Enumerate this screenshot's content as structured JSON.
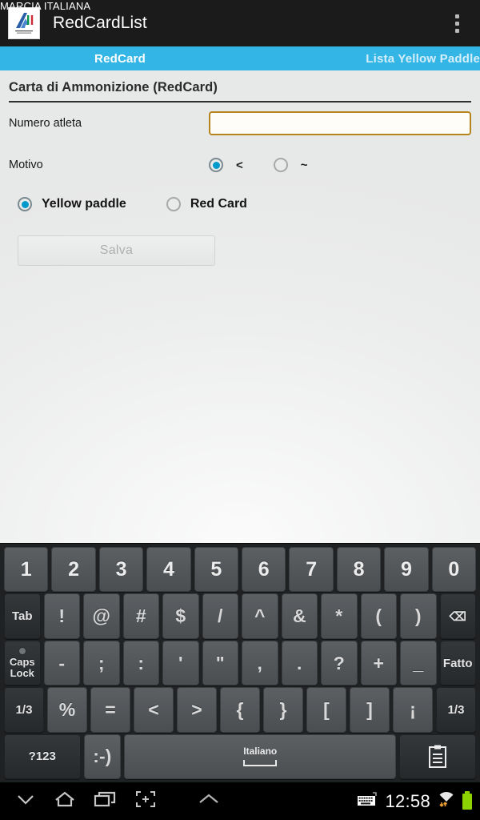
{
  "status_overlay": {
    "text": "MARCIA ITALIANA"
  },
  "actionbar": {
    "logo_icon": "fidal-logo-icon",
    "title": "RedCardList",
    "overflow_icon": "overflow-menu-icon"
  },
  "tabs": [
    {
      "label": "RedCard",
      "active": true
    },
    {
      "label": "Lista Yellow Paddle",
      "active": false
    }
  ],
  "form": {
    "section_title": "Carta di Ammonizione (RedCard)",
    "athlete_number": {
      "label": "Numero atleta",
      "value": "",
      "placeholder": ""
    },
    "motivo": {
      "label": "Motivo",
      "options": [
        {
          "label": "<",
          "checked": true
        },
        {
          "label": "~",
          "checked": false
        }
      ]
    },
    "card_type": {
      "options": [
        {
          "label": "Yellow paddle",
          "checked": true
        },
        {
          "label": "Red Card",
          "checked": false
        }
      ]
    },
    "save_button": {
      "label": "Salva",
      "enabled": false
    }
  },
  "keyboard": {
    "rows": [
      {
        "keys": [
          {
            "label": "1",
            "name": "key-1",
            "style": "num"
          },
          {
            "label": "2",
            "name": "key-2",
            "style": "num"
          },
          {
            "label": "3",
            "name": "key-3",
            "style": "num"
          },
          {
            "label": "4",
            "name": "key-4",
            "style": "num"
          },
          {
            "label": "5",
            "name": "key-5",
            "style": "num"
          },
          {
            "label": "6",
            "name": "key-6",
            "style": "num"
          },
          {
            "label": "7",
            "name": "key-7",
            "style": "num"
          },
          {
            "label": "8",
            "name": "key-8",
            "style": "num"
          },
          {
            "label": "9",
            "name": "key-9",
            "style": "num"
          },
          {
            "label": "0",
            "name": "key-0",
            "style": "num"
          }
        ]
      },
      {
        "keys": [
          {
            "label": "Tab",
            "name": "key-tab",
            "style": "fn dark"
          },
          {
            "label": "!",
            "name": "key-exclam",
            "style": "sym"
          },
          {
            "label": "@",
            "name": "key-at",
            "style": "sym"
          },
          {
            "label": "#",
            "name": "key-hash",
            "style": "sym"
          },
          {
            "label": "$",
            "name": "key-dollar",
            "style": "sym"
          },
          {
            "label": "/",
            "name": "key-slash",
            "style": "sym"
          },
          {
            "label": "^",
            "name": "key-caret",
            "style": "sym"
          },
          {
            "label": "&",
            "name": "key-ampersand",
            "style": "sym"
          },
          {
            "label": "*",
            "name": "key-asterisk",
            "style": "sym"
          },
          {
            "label": "(",
            "name": "key-paren-open",
            "style": "sym"
          },
          {
            "label": ")",
            "name": "key-paren-close",
            "style": "sym"
          },
          {
            "label": "⌫",
            "name": "backspace-icon",
            "style": "fn dark"
          }
        ]
      },
      {
        "keys": [
          {
            "label": "Caps Lock",
            "name": "key-caps-lock",
            "style": "tiny dark"
          },
          {
            "label": "-",
            "name": "key-hyphen",
            "style": "sym"
          },
          {
            "label": ";",
            "name": "key-semicolon",
            "style": "sym"
          },
          {
            "label": ":",
            "name": "key-colon",
            "style": "sym"
          },
          {
            "label": "'",
            "name": "key-apostrophe",
            "style": "sym"
          },
          {
            "label": "\"",
            "name": "key-quote",
            "style": "sym"
          },
          {
            "label": ",",
            "name": "key-comma",
            "style": "sym"
          },
          {
            "label": ".",
            "name": "key-period",
            "style": "sym"
          },
          {
            "label": "?",
            "name": "key-question",
            "style": "sym"
          },
          {
            "label": "+",
            "name": "key-plus",
            "style": "sym"
          },
          {
            "label": "_",
            "name": "key-underscore",
            "style": "sym"
          },
          {
            "label": "Fatto",
            "name": "key-done",
            "style": "fn dark"
          }
        ]
      },
      {
        "keys": [
          {
            "label": "1/3",
            "name": "key-page-left",
            "style": "fn dark"
          },
          {
            "label": "%",
            "name": "key-percent",
            "style": "sym"
          },
          {
            "label": "=",
            "name": "key-equals",
            "style": "sym"
          },
          {
            "label": "<",
            "name": "key-less-than",
            "style": "sym"
          },
          {
            "label": ">",
            "name": "key-greater-than",
            "style": "sym"
          },
          {
            "label": "{",
            "name": "key-brace-open",
            "style": "sym"
          },
          {
            "label": "}",
            "name": "key-brace-close",
            "style": "sym"
          },
          {
            "label": "[",
            "name": "key-bracket-open",
            "style": "sym"
          },
          {
            "label": "]",
            "name": "key-bracket-close",
            "style": "sym"
          },
          {
            "label": "¡",
            "name": "key-inverted-exclam",
            "style": "sym"
          },
          {
            "label": "1/3",
            "name": "key-page-right",
            "style": "fn dark"
          }
        ]
      }
    ],
    "bottom_row": {
      "symbols_key": {
        "label": "?123",
        "name": "key-symbols"
      },
      "emoji_key": {
        "label": ":-)",
        "name": "key-emoji"
      },
      "space_key": {
        "label": "Italiano",
        "name": "key-space"
      },
      "clipboard_key": {
        "label": "clipboard-icon",
        "name": "key-clipboard"
      }
    }
  },
  "navbar": {
    "hide_keyboard_icon": "chevron-down-icon",
    "home_icon": "home-icon",
    "recents_icon": "recents-icon",
    "screenshot_icon": "screenshot-icon",
    "expand_icon": "chevron-up-icon",
    "keyboard_status_icon": "keyboard-icon",
    "time": "12:58",
    "wifi_icon": "wifi-icon",
    "battery_icon": "battery-icon"
  },
  "colors": {
    "accent": "#33b5e5",
    "actionbar_bg": "#1b1b1b",
    "input_border": "#b5841d",
    "radio_fill": "#0099cc",
    "battery_green": "#8cd300"
  }
}
